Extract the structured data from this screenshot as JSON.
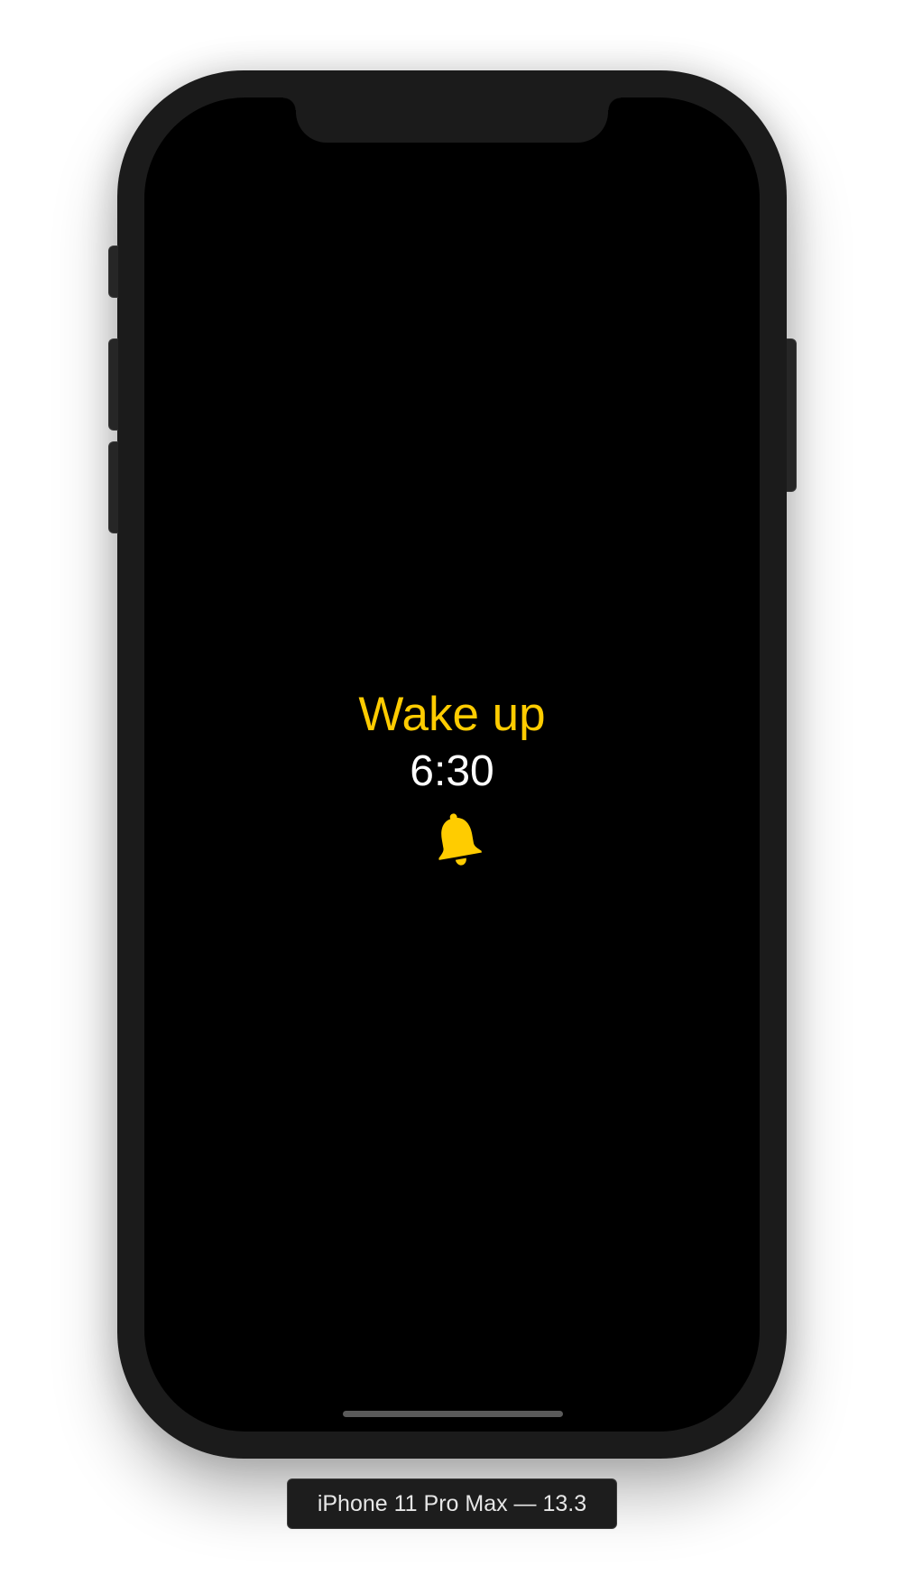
{
  "alarm": {
    "title": "Wake up",
    "time": "6:30",
    "icon": "bell-icon",
    "accent_color": "#FFCC00",
    "time_color": "#FFFFFF"
  },
  "simulator": {
    "device_label": "iPhone 11 Pro Max — 13.3",
    "screen_background": "#000000"
  }
}
